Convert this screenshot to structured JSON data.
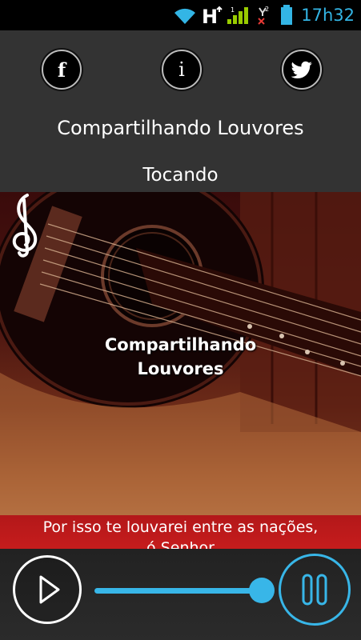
{
  "status_bar": {
    "clock": "17h32",
    "icons": [
      "wifi-icon",
      "hspa-icon",
      "signal-icon",
      "sim2-no-signal-icon",
      "battery-icon"
    ],
    "accent_color": "#33b5e5"
  },
  "header": {
    "social": [
      {
        "name": "facebook",
        "glyph": "f"
      },
      {
        "name": "info",
        "glyph": "i"
      },
      {
        "name": "twitter",
        "glyph": "twitter-bird-icon"
      }
    ],
    "station_title": "Compartilhando Louvores",
    "status": "Tocando"
  },
  "artwork": {
    "logo_line1": "Compartilhando",
    "logo_line2": "Louvores",
    "lyric_line1": "Por isso te louvarei entre as nações,",
    "lyric_line2": "ó Senhor"
  },
  "player": {
    "play_icon": "play-icon",
    "pause_icon": "pause-icon",
    "volume_level": 0.92,
    "accent_color": "#38b6e8"
  }
}
